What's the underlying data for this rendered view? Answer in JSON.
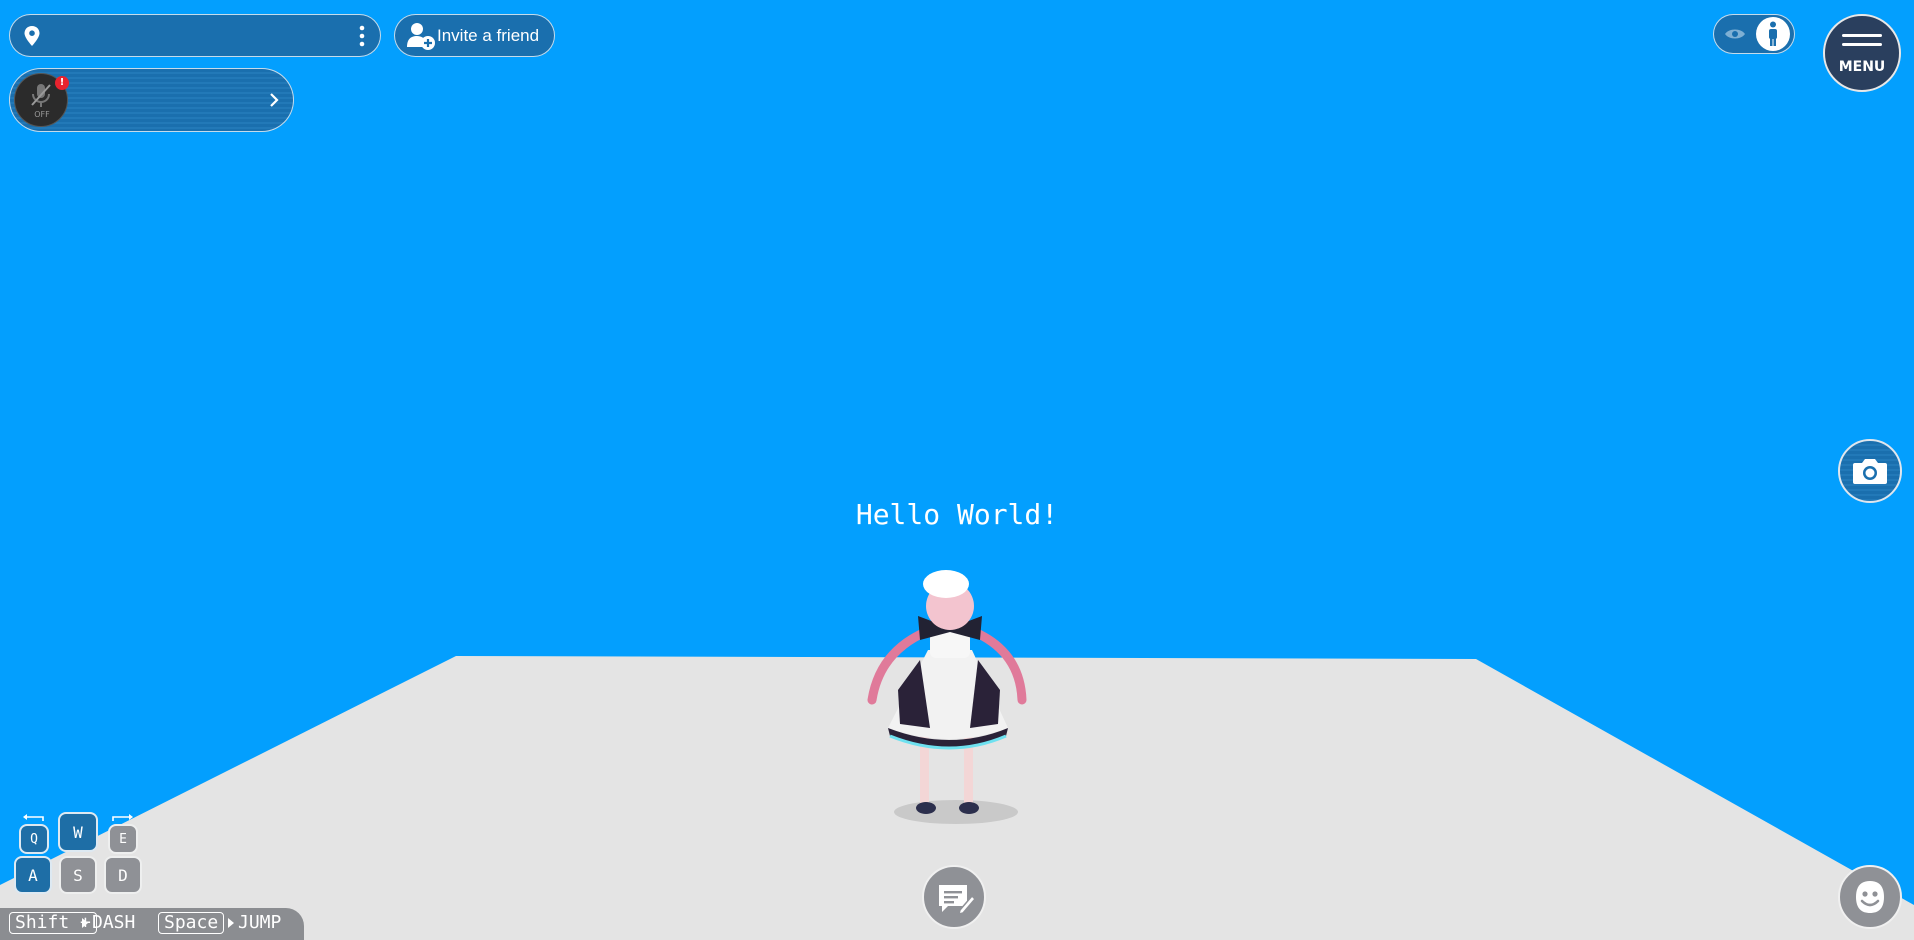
{
  "top_left": {
    "invite_label": "Invite a friend",
    "mic_state": "OFF",
    "mic_badge": "!"
  },
  "top_right": {
    "menu_label": "MENU"
  },
  "scene": {
    "hello_text": "Hello World!",
    "sky_color": "#039ffe",
    "floor_color": "#e4e4e4"
  },
  "controls": {
    "keys": {
      "q": "Q",
      "w": "W",
      "e": "E",
      "a": "A",
      "s": "S",
      "d": "D"
    },
    "shift_key": "Shift +",
    "dash_label": "DASH",
    "space_key": "Space",
    "jump_label": "JUMP"
  }
}
